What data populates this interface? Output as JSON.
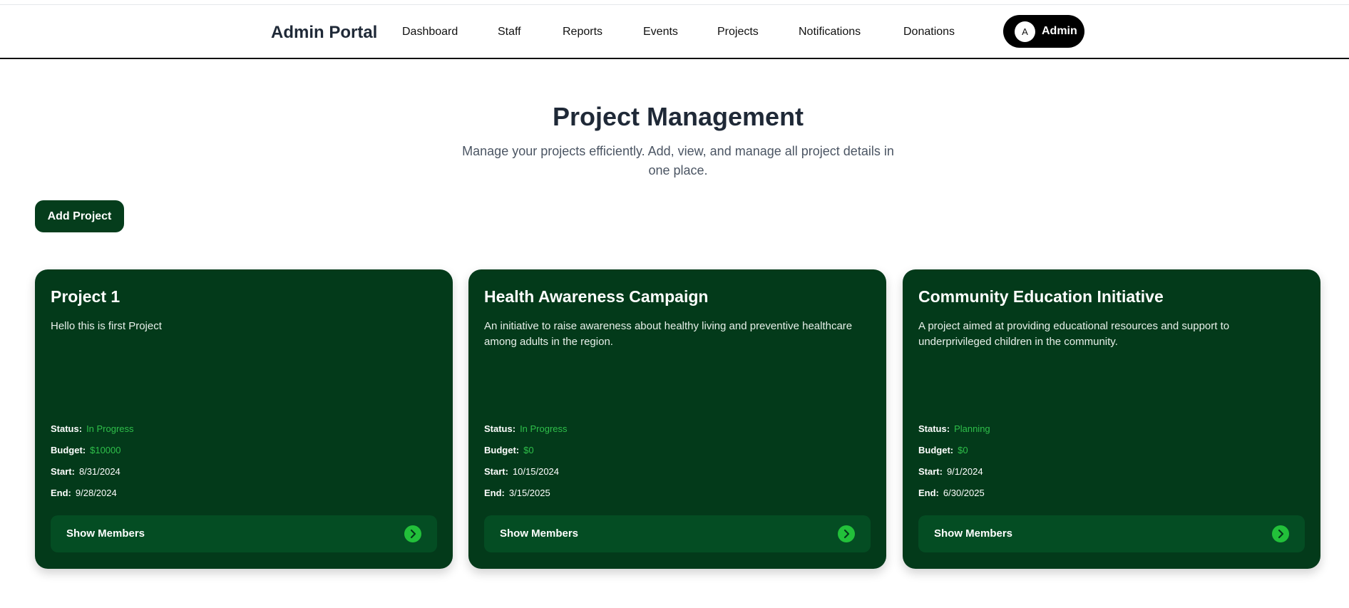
{
  "header": {
    "brand": "Admin Portal",
    "nav": [
      {
        "label": "Dashboard"
      },
      {
        "label": "Staff"
      },
      {
        "label": "Reports"
      },
      {
        "label": "Events"
      },
      {
        "label": "Projects"
      },
      {
        "label": "Notifications"
      },
      {
        "label": "Donations"
      }
    ],
    "user": {
      "avatar_letter": "A",
      "label": "Admin"
    }
  },
  "main": {
    "title": "Project Management",
    "subtitle": "Manage your projects efficiently. Add, view, and manage all project details in one place.",
    "add_button": "Add Project"
  },
  "labels": {
    "status": "Status:",
    "budget": "Budget:",
    "start": "Start:",
    "end": "End:",
    "show_members": "Show Members"
  },
  "projects": [
    {
      "title": "Project 1",
      "description": "Hello this is first Project",
      "status": "In Progress",
      "budget": "$10000",
      "start": "8/31/2024",
      "end": "9/28/2024"
    },
    {
      "title": "Health Awareness Campaign",
      "description": "An initiative to raise awareness about healthy living and preventive healthcare among adults in the region.",
      "status": "In Progress",
      "budget": "$0",
      "start": "10/15/2024",
      "end": "3/15/2025"
    },
    {
      "title": "Community Education Initiative",
      "description": "A project aimed at providing educational resources and support to underprivileged children in the community.",
      "status": "Planning",
      "budget": "$0",
      "start": "9/1/2024",
      "end": "6/30/2025"
    }
  ],
  "colors": {
    "card_bg": "#033a1a",
    "accent_green": "#2fbf4a",
    "button_dark": "#053d1c"
  },
  "icons": {
    "show_members": "chevron-right-icon"
  }
}
